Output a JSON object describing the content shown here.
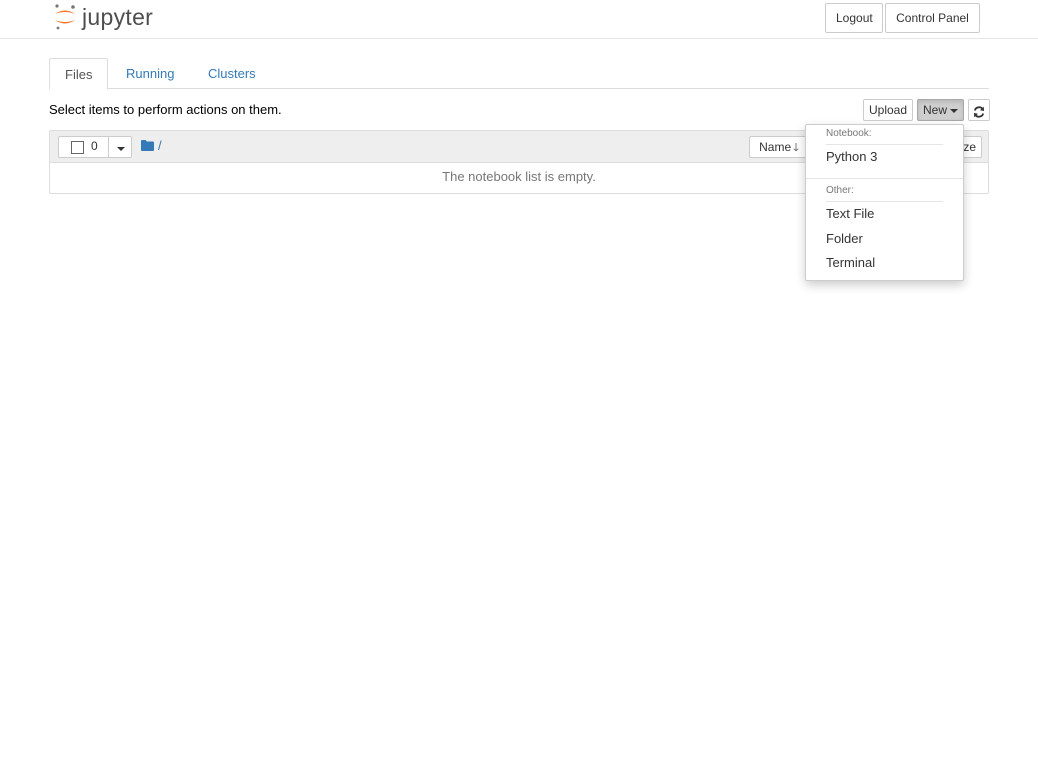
{
  "header": {
    "logo_text": "jupyter",
    "logout_label": "Logout",
    "control_panel_label": "Control Panel"
  },
  "tabs": [
    {
      "label": "Files",
      "active": true
    },
    {
      "label": "Running",
      "active": false
    },
    {
      "label": "Clusters",
      "active": false
    }
  ],
  "toolbar": {
    "hint": "Select items to perform actions on them.",
    "upload_label": "Upload",
    "new_label": "New"
  },
  "file_list": {
    "selected_count": "0",
    "breadcrumb": "/",
    "sort_name_label": "Name",
    "sort_size_label": "ze",
    "empty_message": "The notebook list is empty."
  },
  "new_menu": {
    "notebook_header": "Notebook:",
    "notebook_items": [
      "Python 3"
    ],
    "other_header": "Other:",
    "other_items": [
      "Text File",
      "Folder",
      "Terminal"
    ]
  },
  "colors": {
    "link_blue": "#337ab7",
    "jupyter_orange": "#f37726",
    "logo_gray": "#4e4e4e",
    "folder_blue": "#337ab7"
  },
  "icons": {
    "logo": "jupyter-logo-icon",
    "refresh": "refresh-icon",
    "folder": "folder-icon",
    "sort": "arrow-down-icon",
    "caret": "caret-down-icon"
  }
}
